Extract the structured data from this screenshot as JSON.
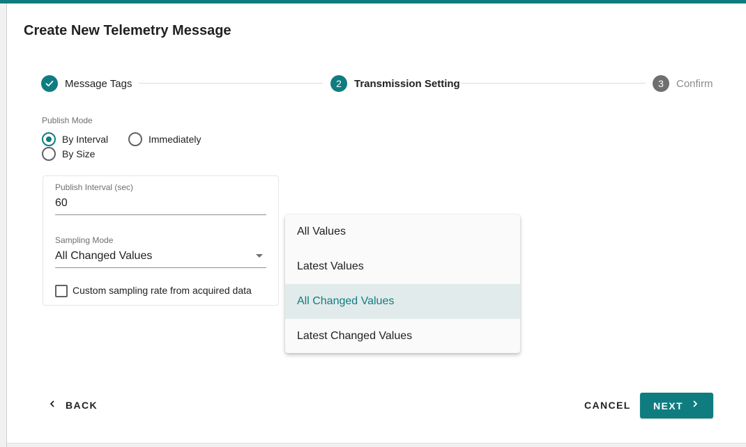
{
  "dialog": {
    "title": "Create New Telemetry Message"
  },
  "stepper": {
    "steps": [
      {
        "number": "1",
        "label": "Message Tags",
        "state": "completed"
      },
      {
        "number": "2",
        "label": "Transmission Setting",
        "state": "active"
      },
      {
        "number": "3",
        "label": "Confirm",
        "state": "upcoming"
      }
    ]
  },
  "publish_mode": {
    "label": "Publish Mode",
    "options": [
      {
        "label": "By Interval",
        "selected": true
      },
      {
        "label": "Immediately",
        "selected": false
      },
      {
        "label": "By Size",
        "selected": false
      }
    ]
  },
  "publish_interval": {
    "label": "Publish Interval (sec)",
    "value": "60"
  },
  "sampling_mode": {
    "label": "Sampling Mode",
    "value": "All Changed Values",
    "options": [
      "All Values",
      "Latest Values",
      "All Changed Values",
      "Latest Changed Values"
    ],
    "selected_index": 2
  },
  "custom_sampling": {
    "label": "Custom sampling rate from acquired data",
    "checked": false
  },
  "actions": {
    "back": "BACK",
    "cancel": "CANCEL",
    "next": "NEXT"
  },
  "colors": {
    "primary": "#0f7c80",
    "inactive_step": "#6f6f6f",
    "selected_menu_bg": "#e2ebeb"
  }
}
